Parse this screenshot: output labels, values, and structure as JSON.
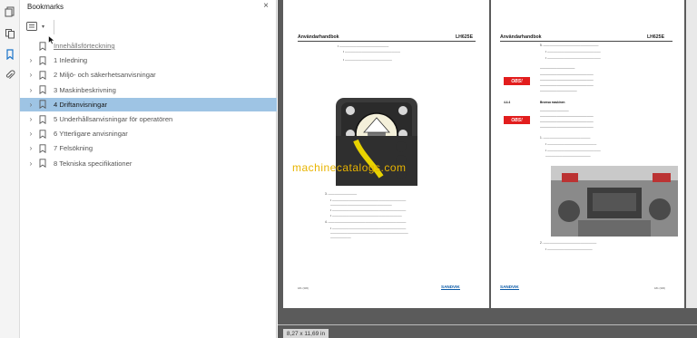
{
  "panel": {
    "title": "Bookmarks",
    "close_glyph": "×"
  },
  "rail_icons": [
    "pages-icon",
    "copy-icon",
    "bookmark-icon",
    "attachment-icon"
  ],
  "bookmarks": [
    {
      "label": "Innehållsförteckning",
      "expandable": false,
      "underline": true,
      "selected": false
    },
    {
      "label": "1 Inledning",
      "expandable": true,
      "underline": false,
      "selected": false
    },
    {
      "label": "2 Miljö- och säkerhetsanvisningar",
      "expandable": true,
      "underline": false,
      "selected": false
    },
    {
      "label": "3 Maskinbeskrivning",
      "expandable": true,
      "underline": false,
      "selected": false
    },
    {
      "label": "4 Driftanvisningar",
      "expandable": true,
      "underline": false,
      "selected": true
    },
    {
      "label": "5 Underhållsanvisningar för operatören",
      "expandable": true,
      "underline": false,
      "selected": false
    },
    {
      "label": "6 Ytterligare anvisningar",
      "expandable": true,
      "underline": false,
      "selected": false
    },
    {
      "label": "7 Felsökning",
      "expandable": true,
      "underline": false,
      "selected": false
    },
    {
      "label": "8 Tekniska specifikationer",
      "expandable": true,
      "underline": false,
      "selected": false
    }
  ],
  "doc": {
    "left_header": "Användarhandbok",
    "left_model": "LH625E",
    "right_header": "Användarhandbok",
    "right_model": "LH625E",
    "obs_label": "OBS!",
    "section": "4.4.4",
    "section_title": "Bromsa maskinen",
    "watermark": "machinecatalogs.com",
    "brand": "SANDVIK",
    "left_page_num": "181 (336)",
    "right_page_num": "181 (336)",
    "page_size": "8,27 x 11,69 in"
  },
  "colors": {
    "selected_bookmark": "#9ec4e4",
    "obs_red": "#e21d1d",
    "sandvik_blue": "#0a5aa7",
    "viewer_bg": "#5b5b5b"
  }
}
